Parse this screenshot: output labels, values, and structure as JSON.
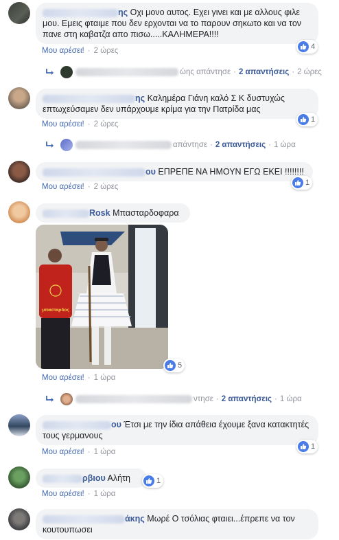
{
  "like_label": "Μου αρέσει!",
  "dot": "·",
  "comments": [
    {
      "text": "Οχι μονο αυτος. Εχει γινει και με αλλους φιλε μου. Εμεις φταιμε που δεν ερχονται να το παρουν σηκωτο και να τον πανε στη καβατζα απο πισω.....ΚΑΛΗΜΕΡΑ!!!!",
      "name_visible": "ης",
      "time": "2 ώρες",
      "likes": "4",
      "replies": {
        "visible_name_end": "ώης απάντησε",
        "count_label": "2 απαντήσεις",
        "time": "2 ώρες"
      }
    },
    {
      "text": "Καλημέρα Γιάνη καλό Σ Κ δυστυχώς επτωχεύσαμεν δεν υπάρχουμε κρίμα για την Πατρίδα μας",
      "name_visible": "ης",
      "time": "2 ώρες",
      "likes": "1",
      "replies": {
        "visible_name_end": "απάντησε",
        "count_label": "2 απαντήσεις",
        "time": "1 ώρα"
      }
    },
    {
      "text": "ΕΠΡΕΠΕ ΝΑ ΗΜΟΥΝ ΕΓΩ ΕΚΕΙ !!!!!!!!",
      "name_visible": "ου",
      "time": "2 ώρες",
      "likes": "1"
    },
    {
      "text": "Μπασταρδοφαρα",
      "name_visible": "Rosk",
      "time": "1 ώρα",
      "likes": "5",
      "photo_shirt_text": "μπασταρδος",
      "replies": {
        "visible_name_end": "ντησε",
        "count_label": "2 απαντήσεις",
        "time": "1 ώρα"
      }
    },
    {
      "text": "Έτσι με την ίδια απάθεια έχουμε ξανα κατακτητές τους γερμανους",
      "name_visible": "ου",
      "time": "1 ώρα",
      "likes": "1"
    },
    {
      "text": "Αλήτη",
      "name_visible": "ρβιου",
      "time": "1 ώρα",
      "likes": "1"
    },
    {
      "text": "Μωρέ Ο τσόλιας φταιει...έπρεπε να τον κουτουπωσει",
      "name_visible": "άκης"
    }
  ],
  "colors": {
    "link": "#385898",
    "like_blue": "#4267b2",
    "bubble_bg": "#f2f3f5",
    "meta_grey": "#90949c"
  },
  "icons": {
    "like": "like-thumb-icon",
    "reply": "reply-arrow-icon"
  }
}
